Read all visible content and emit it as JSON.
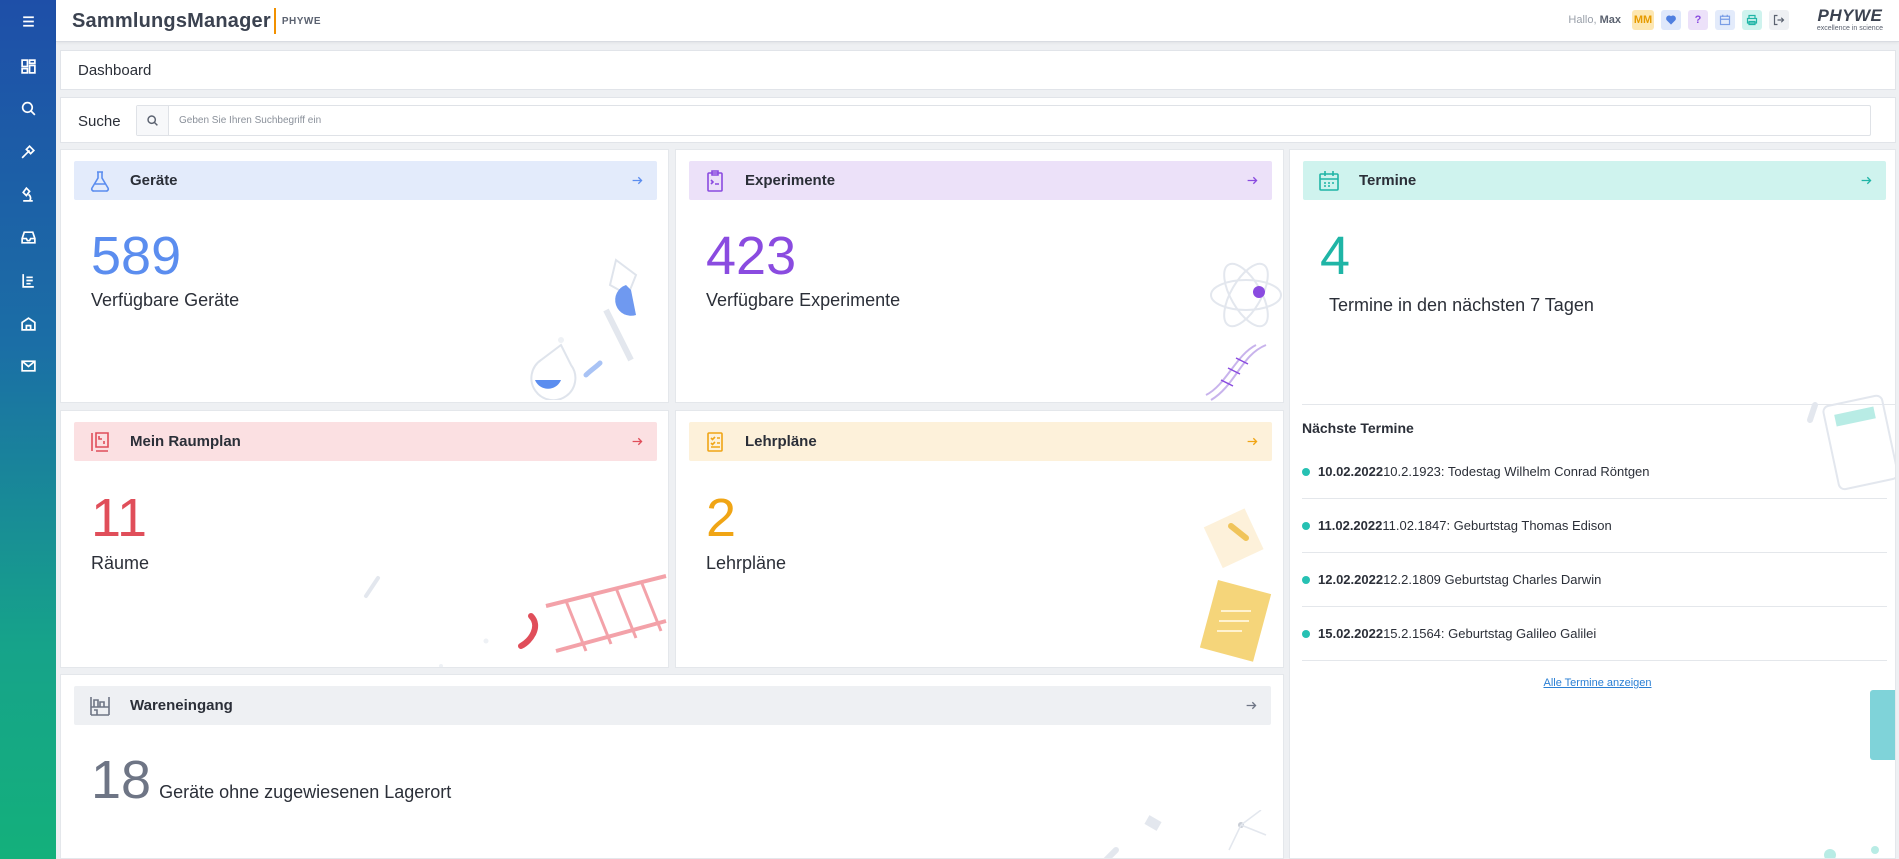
{
  "app": {
    "brand_name": "SammlungsManager",
    "brand_suffix": "PHYWE",
    "logo_big": "PHYWE",
    "logo_small": "excellence in science"
  },
  "sidebar": {
    "items": [
      {
        "name": "menu",
        "icon": "hamburger-icon"
      },
      {
        "name": "dashboard",
        "icon": "dashboard-icon"
      },
      {
        "name": "search",
        "icon": "search-icon"
      },
      {
        "name": "devices",
        "icon": "tools-icon"
      },
      {
        "name": "experiments",
        "icon": "microscope-icon"
      },
      {
        "name": "storage",
        "icon": "inbox-icon"
      },
      {
        "name": "curricula",
        "icon": "list-icon"
      },
      {
        "name": "rooms",
        "icon": "building-icon"
      },
      {
        "name": "messages",
        "icon": "mail-icon"
      }
    ]
  },
  "topbar": {
    "greeting": "Hallo,",
    "user_name": "Max",
    "avatar_initials": "MM",
    "help_label": "?"
  },
  "page": {
    "title": "Dashboard"
  },
  "search": {
    "label": "Suche",
    "placeholder": "Geben Sie Ihren Suchbegriff ein",
    "value": ""
  },
  "cards": {
    "geraete": {
      "title": "Geräte",
      "count": "589",
      "subtitle": "Verfügbare Geräte",
      "color": "#5b8def",
      "head_bg": "#e3ebfb"
    },
    "experimente": {
      "title": "Experimente",
      "count": "423",
      "subtitle": "Verfügbare Experimente",
      "color": "#8a4be0",
      "head_bg": "#ece1f9"
    },
    "termine": {
      "title": "Termine",
      "count": "4",
      "subtitle": "Termine in den nächsten 7 Tagen",
      "color": "#1fb5a6",
      "head_bg": "#cff3ee"
    },
    "raumplan": {
      "title": "Mein Raumplan",
      "count": "11",
      "subtitle": "Räume",
      "color": "#e04e5a",
      "head_bg": "#fbe0e2"
    },
    "lehrplaene": {
      "title": "Lehrpläne",
      "count": "2",
      "subtitle": "Lehrpläne",
      "color": "#f0a515",
      "head_bg": "#fdf1da"
    },
    "wareneingang": {
      "title": "Wareneingang",
      "count": "18",
      "subtitle": "Geräte ohne zugewiesenen Lagerort",
      "color": "#6e7585",
      "head_bg": "#eef0f3"
    }
  },
  "next_termine": {
    "title": "Nächste Termine",
    "items": [
      {
        "date": "10.02.2022",
        "text": "10.2.1923: Todestag Wilhelm Conrad Röntgen"
      },
      {
        "date": "11.02.2022",
        "text": "11.02.1847: Geburtstag Thomas Edison"
      },
      {
        "date": "12.02.2022",
        "text": "12.2.1809 Geburtstag Charles Darwin"
      },
      {
        "date": "15.02.2022",
        "text": "15.2.1564: Geburtstag Galileo Galilei"
      }
    ],
    "link": "Alle Termine anzeigen"
  }
}
